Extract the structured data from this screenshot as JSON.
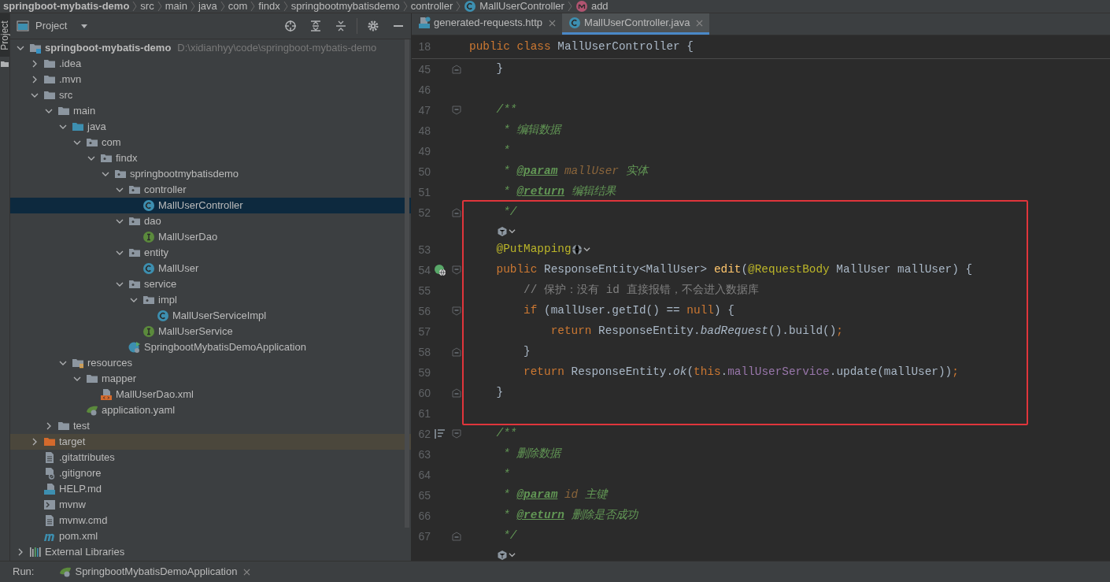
{
  "breadcrumb": [
    {
      "label": "springboot-mybatis-demo",
      "bold": true
    },
    {
      "label": "src",
      "bold": false
    },
    {
      "label": "main",
      "bold": false
    },
    {
      "label": "java",
      "bold": false
    },
    {
      "label": "com",
      "bold": false
    },
    {
      "label": "findx",
      "bold": false
    },
    {
      "label": "springbootmybatisdemo",
      "bold": false
    },
    {
      "label": "controller",
      "bold": false
    },
    {
      "label": "MallUserController",
      "bold": false,
      "kind": "class"
    },
    {
      "label": "add",
      "bold": false,
      "kind": "method"
    }
  ],
  "side_strip": {
    "label": "Project"
  },
  "project_panel": {
    "title": "Project",
    "tree": [
      {
        "label": "springboot-mybatis-demo",
        "path": "D:\\xidianhyy\\code\\springboot-mybatis-demo",
        "kind": "module",
        "expanded": true,
        "selected": false,
        "highlighted": false,
        "children": [
          {
            "label": ".idea",
            "kind": "folder",
            "expanded": false,
            "selected": false,
            "highlighted": false
          },
          {
            "label": ".mvn",
            "kind": "folder",
            "expanded": false,
            "selected": false,
            "highlighted": false
          },
          {
            "label": "src",
            "kind": "folder",
            "expanded": true,
            "selected": false,
            "highlighted": false,
            "children": [
              {
                "label": "main",
                "kind": "folder",
                "expanded": true,
                "selected": false,
                "highlighted": false,
                "children": [
                  {
                    "label": "java",
                    "kind": "source-folder",
                    "expanded": true,
                    "selected": false,
                    "highlighted": false,
                    "children": [
                      {
                        "label": "com",
                        "kind": "package",
                        "expanded": true,
                        "selected": false,
                        "highlighted": false,
                        "children": [
                          {
                            "label": "findx",
                            "kind": "package",
                            "expanded": true,
                            "selected": false,
                            "highlighted": false,
                            "children": [
                              {
                                "label": "springbootmybatisdemo",
                                "kind": "package",
                                "expanded": true,
                                "selected": false,
                                "highlighted": false,
                                "children": [
                                  {
                                    "label": "controller",
                                    "kind": "package",
                                    "expanded": true,
                                    "selected": false,
                                    "highlighted": false,
                                    "children": [
                                      {
                                        "label": "MallUserController",
                                        "kind": "class",
                                        "selected": true,
                                        "highlighted": false
                                      }
                                    ]
                                  },
                                  {
                                    "label": "dao",
                                    "kind": "package",
                                    "expanded": true,
                                    "selected": false,
                                    "highlighted": false,
                                    "children": [
                                      {
                                        "label": "MallUserDao",
                                        "kind": "interface",
                                        "selected": false,
                                        "highlighted": false
                                      }
                                    ]
                                  },
                                  {
                                    "label": "entity",
                                    "kind": "package",
                                    "expanded": true,
                                    "selected": false,
                                    "highlighted": false,
                                    "children": [
                                      {
                                        "label": "MallUser",
                                        "kind": "class",
                                        "selected": false,
                                        "highlighted": false
                                      }
                                    ]
                                  },
                                  {
                                    "label": "service",
                                    "kind": "package",
                                    "expanded": true,
                                    "selected": false,
                                    "highlighted": false,
                                    "children": [
                                      {
                                        "label": "impl",
                                        "kind": "package",
                                        "expanded": true,
                                        "selected": false,
                                        "highlighted": false,
                                        "children": [
                                          {
                                            "label": "MallUserServiceImpl",
                                            "kind": "class",
                                            "selected": false,
                                            "highlighted": false
                                          }
                                        ]
                                      },
                                      {
                                        "label": "MallUserService",
                                        "kind": "interface",
                                        "selected": false,
                                        "highlighted": false
                                      }
                                    ]
                                  },
                                  {
                                    "label": "SpringbootMybatisDemoApplication",
                                    "kind": "spring-class",
                                    "selected": false,
                                    "highlighted": false
                                  }
                                ]
                              }
                            ]
                          }
                        ]
                      }
                    ]
                  },
                  {
                    "label": "resources",
                    "kind": "resources",
                    "expanded": true,
                    "selected": false,
                    "highlighted": false,
                    "children": [
                      {
                        "label": "mapper",
                        "kind": "folder",
                        "expanded": true,
                        "selected": false,
                        "highlighted": false,
                        "children": [
                          {
                            "label": "MallUserDao.xml",
                            "kind": "xml",
                            "selected": false,
                            "highlighted": false
                          }
                        ]
                      },
                      {
                        "label": "application.yaml",
                        "kind": "spring-config",
                        "selected": false,
                        "highlighted": false
                      }
                    ]
                  }
                ]
              },
              {
                "label": "test",
                "kind": "folder",
                "expanded": false,
                "selected": false,
                "highlighted": false
              }
            ]
          },
          {
            "label": "target",
            "kind": "excluded-folder",
            "expanded": false,
            "selected": false,
            "highlighted": true
          },
          {
            "label": ".gitattributes",
            "kind": "text",
            "selected": false,
            "highlighted": false
          },
          {
            "label": ".gitignore",
            "kind": "ignore",
            "selected": false,
            "highlighted": false
          },
          {
            "label": "HELP.md",
            "kind": "markdown",
            "selected": false,
            "highlighted": false
          },
          {
            "label": "mvnw",
            "kind": "shell",
            "selected": false,
            "highlighted": false
          },
          {
            "label": "mvnw.cmd",
            "kind": "text",
            "selected": false,
            "highlighted": false
          },
          {
            "label": "pom.xml",
            "kind": "maven",
            "selected": false,
            "highlighted": false
          }
        ]
      },
      {
        "label": "External Libraries",
        "kind": "libraries",
        "expanded": false,
        "selected": false,
        "highlighted": false
      }
    ]
  },
  "tabs": [
    {
      "label": "generated-requests.http",
      "kind": "api",
      "selected": false
    },
    {
      "label": "MallUserController.java",
      "kind": "class",
      "selected": true
    }
  ],
  "editor": {
    "sticky_line": {
      "number": "18",
      "tokens": [
        {
          "t": "public class ",
          "kind": "kw"
        },
        {
          "t": "MallUserController {",
          "kind": "plain"
        }
      ]
    },
    "blocks": [
      {
        "boxed": false,
        "lines": [
          {
            "kind": "code",
            "number": "45",
            "fold": {
              "kind": "close"
            },
            "tokens": [
              {
                "t": "    }",
                "kind": "plain"
              }
            ]
          },
          {
            "kind": "code",
            "number": "46"
          },
          {
            "kind": "code",
            "number": "47",
            "fold": {
              "kind": "open"
            },
            "tokens": [
              {
                "t": "    /**",
                "kind": "doc"
              }
            ]
          },
          {
            "kind": "code",
            "number": "48",
            "tokens": [
              {
                "t": "     * 编辑数据",
                "kind": "doc"
              }
            ]
          },
          {
            "kind": "code",
            "number": "49",
            "tokens": [
              {
                "t": "     *",
                "kind": "doc"
              }
            ]
          },
          {
            "kind": "code",
            "number": "50",
            "tokens": [
              {
                "t": "     * ",
                "kind": "doc"
              },
              {
                "t": "@param",
                "kind": "doctag"
              },
              {
                "t": " mallUser",
                "kind": "docparam"
              },
              {
                "t": " 实体",
                "kind": "doc"
              }
            ]
          },
          {
            "kind": "code",
            "number": "51",
            "tokens": [
              {
                "t": "     * ",
                "kind": "doc"
              },
              {
                "t": "@return",
                "kind": "doctag"
              },
              {
                "t": " 编辑结果",
                "kind": "doc"
              }
            ]
          }
        ]
      },
      {
        "boxed": true,
        "lines": [
          {
            "kind": "code",
            "number": "52",
            "fold": {
              "kind": "close"
            },
            "tokens": [
              {
                "t": "     */",
                "kind": "doc"
              }
            ]
          },
          {
            "kind": "hint"
          },
          {
            "kind": "code",
            "number": "53",
            "tokens": [
              {
                "t": "    @PutMapping",
                "kind": "ann"
              },
              {
                "kind": "inlay"
              }
            ]
          },
          {
            "kind": "code",
            "number": "54",
            "fold": {
              "kind": "open"
            },
            "gutter": {
              "kind": "endpoint"
            },
            "tokens": [
              {
                "t": "    public ",
                "kind": "kw"
              },
              {
                "t": "ResponseEntity<MallUser> ",
                "kind": "plain"
              },
              {
                "t": "edit",
                "kind": "fn"
              },
              {
                "t": "(",
                "kind": "plain"
              },
              {
                "t": "@RequestBody",
                "kind": "ann"
              },
              {
                "t": " MallUser mallUser) {",
                "kind": "plain"
              }
            ]
          },
          {
            "kind": "code",
            "number": "55",
            "tokens": [
              {
                "t": "        // 保护：没有 id 直接报错，不会进入数据库",
                "kind": "comment"
              }
            ]
          },
          {
            "kind": "code",
            "number": "56",
            "fold": {
              "kind": "open"
            },
            "tokens": [
              {
                "t": "        if ",
                "kind": "kw"
              },
              {
                "t": "(mallUser.getId() == ",
                "kind": "plain"
              },
              {
                "t": "null",
                "kind": "kw"
              },
              {
                "t": ") {",
                "kind": "plain"
              }
            ]
          },
          {
            "kind": "code",
            "number": "57",
            "tokens": [
              {
                "t": "            return ",
                "kind": "kw"
              },
              {
                "t": "ResponseEntity.",
                "kind": "plain"
              },
              {
                "t": "badRequest",
                "kind": "static"
              },
              {
                "t": "().build()",
                "kind": "plain"
              },
              {
                "t": ";",
                "kind": "kw"
              }
            ]
          },
          {
            "kind": "code",
            "number": "58",
            "fold": {
              "kind": "close"
            },
            "tokens": [
              {
                "t": "        }",
                "kind": "plain"
              }
            ]
          },
          {
            "kind": "code",
            "number": "59",
            "tokens": [
              {
                "t": "        return ",
                "kind": "kw"
              },
              {
                "t": "ResponseEntity.",
                "kind": "plain"
              },
              {
                "t": "ok",
                "kind": "static"
              },
              {
                "t": "(",
                "kind": "plain"
              },
              {
                "t": "this",
                "kind": "kw"
              },
              {
                "t": ".",
                "kind": "plain"
              },
              {
                "t": "mallUserService",
                "kind": "field"
              },
              {
                "t": ".update(mallUser))",
                "kind": "plain"
              },
              {
                "t": ";",
                "kind": "kw"
              }
            ]
          },
          {
            "kind": "code",
            "number": "60",
            "fold": {
              "kind": "close"
            },
            "tokens": [
              {
                "t": "    }",
                "kind": "plain"
              }
            ]
          },
          {
            "kind": "code",
            "number": "61"
          }
        ]
      },
      {
        "boxed": false,
        "lines": [
          {
            "kind": "code",
            "number": "62",
            "fold": {
              "kind": "open"
            },
            "gutter": {
              "kind": "structure"
            },
            "tokens": [
              {
                "t": "    /**",
                "kind": "doc"
              }
            ]
          },
          {
            "kind": "code",
            "number": "63",
            "tokens": [
              {
                "t": "     * 删除数据",
                "kind": "doc"
              }
            ]
          },
          {
            "kind": "code",
            "number": "64",
            "tokens": [
              {
                "t": "     *",
                "kind": "doc"
              }
            ]
          },
          {
            "kind": "code",
            "number": "65",
            "tokens": [
              {
                "t": "     * ",
                "kind": "doc"
              },
              {
                "t": "@param",
                "kind": "doctag"
              },
              {
                "t": " id",
                "kind": "docparam"
              },
              {
                "t": " 主键",
                "kind": "doc"
              }
            ]
          },
          {
            "kind": "code",
            "number": "66",
            "tokens": [
              {
                "t": "     * ",
                "kind": "doc"
              },
              {
                "t": "@return",
                "kind": "doctag"
              },
              {
                "t": " 删除是否成功",
                "kind": "doc"
              }
            ]
          },
          {
            "kind": "code",
            "number": "67",
            "fold": {
              "kind": "close"
            },
            "tokens": [
              {
                "t": "     */",
                "kind": "doc"
              }
            ]
          },
          {
            "kind": "hint"
          }
        ]
      }
    ]
  },
  "run_bar": {
    "label": "Run:",
    "tab": "SpringbootMybatisDemoApplication"
  }
}
